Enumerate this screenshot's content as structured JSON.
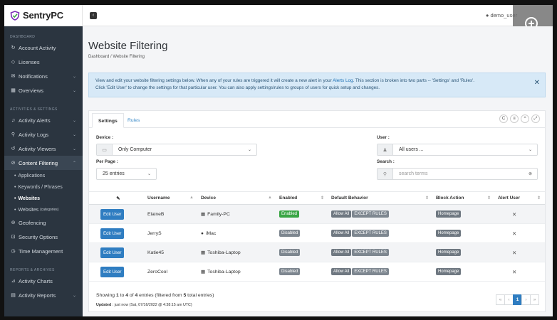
{
  "brand": {
    "name": "SentryPC"
  },
  "topbar": {
    "user": "demo_user"
  },
  "sidebar": {
    "sections": [
      "DASHBOARD",
      "ACTIVITIES & SETTINGS",
      "REPORTS & ARCHIVES"
    ],
    "items": [
      {
        "label": "Account Activity",
        "icon": "history-icon"
      },
      {
        "label": "Licenses",
        "icon": "tag-icon"
      },
      {
        "label": "Notifications",
        "icon": "envelope-icon"
      },
      {
        "label": "Overviews",
        "icon": "calendar-icon"
      },
      {
        "label": "Activity Alerts",
        "icon": "bell-icon"
      },
      {
        "label": "Activity Logs",
        "icon": "search-icon"
      },
      {
        "label": "Activity Viewers",
        "icon": "refresh-icon"
      },
      {
        "label": "Content Filtering",
        "icon": "ban-icon"
      },
      {
        "label": "Geofencing",
        "icon": "map-pin-icon"
      },
      {
        "label": "Security Options",
        "icon": "lock-icon"
      },
      {
        "label": "Time Management",
        "icon": "clock-icon"
      },
      {
        "label": "Activity Charts",
        "icon": "chart-icon"
      },
      {
        "label": "Activity Reports",
        "icon": "file-icon"
      }
    ],
    "sub_items": [
      "Applications",
      "Keywords / Phrases",
      "Websites",
      "Websites"
    ],
    "sub_note": "(categories)"
  },
  "page": {
    "title": "Website Filtering",
    "breadcrumb": "Dashboard  /  Website Filtering",
    "alert_1": "View and edit your website filtering settings below.  When any of your rules are triggered it will create a new alert in your ",
    "alert_link": "Alerts Log",
    "alert_2": ".  This section is broken into two parts -- 'Settings' and 'Rules'.",
    "alert_3": "Click 'Edit User' to change the settings for that particular user.  You can also apply settings/rules to groups of users for quick setup and changes."
  },
  "tabs": [
    "Settings",
    "Rules"
  ],
  "filters": {
    "device_label": "Device :",
    "device_value": "Only Computer",
    "perpage_label": "Per Page :",
    "perpage_value": "25 entries",
    "user_label": "User :",
    "user_value": "All users ...",
    "search_label": "Search :",
    "search_placeholder": "search terms"
  },
  "table": {
    "headers": [
      "Username",
      "Device",
      "Enabled",
      "Default Behavior",
      "Block Action",
      "Alert User"
    ],
    "edit_label": "Edit User",
    "allow_label": "Allow All",
    "except_label": "EXCEPT RULES",
    "block_label": "Homepage",
    "rows": [
      {
        "username": "ElaineB",
        "device": "Family-PC",
        "device_icon": "windows-icon",
        "enabled": "Enabled"
      },
      {
        "username": "JerryS",
        "device": "iMac",
        "device_icon": "apple-icon",
        "enabled": "Disabled"
      },
      {
        "username": "Katie45",
        "device": "Toshiba-Laptop",
        "device_icon": "windows-icon",
        "enabled": "Disabled"
      },
      {
        "username": "ZeroCool",
        "device": "Toshiba-Laptop",
        "device_icon": "windows-icon",
        "enabled": "Disabled"
      }
    ]
  },
  "footer": {
    "showing_1": "Showing ",
    "from": "1",
    "showing_2": " to ",
    "to": "4",
    "showing_3": " of ",
    "of": "4",
    "showing_4": " entries (filtered from ",
    "total": "5",
    "showing_5": " total entries)",
    "updated_label": "Updated",
    "updated_text": " : just now (Sat, 07/16/2022 @ 4:38:15 am UTC)"
  },
  "pager": {
    "first": "«",
    "prev": "‹",
    "current": "1",
    "next": "›",
    "last": "»"
  },
  "colors": {
    "primary": "#2f7dc1",
    "sidebar": "#2b3540",
    "success": "#3aa545",
    "muted": "#7d868f",
    "alert_bg": "#d7e9f7"
  }
}
